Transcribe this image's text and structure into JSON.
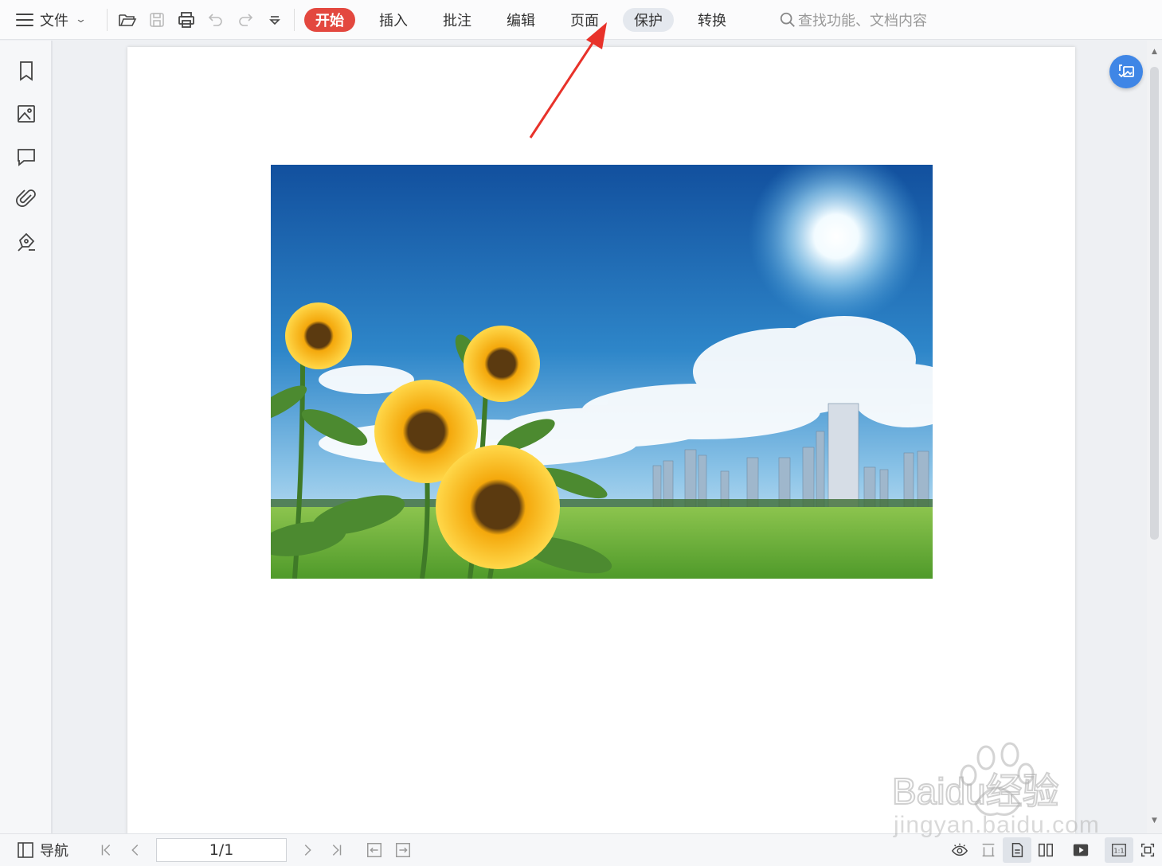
{
  "toolbar": {
    "file_label": "文件",
    "tabs": [
      {
        "label": "开始",
        "state": "active"
      },
      {
        "label": "插入",
        "state": "normal"
      },
      {
        "label": "批注",
        "state": "normal"
      },
      {
        "label": "编辑",
        "state": "normal"
      },
      {
        "label": "页面",
        "state": "normal"
      },
      {
        "label": "保护",
        "state": "hover"
      },
      {
        "label": "转换",
        "state": "normal"
      }
    ],
    "search_placeholder": "查找功能、文档内容",
    "quick_icons": [
      "folder-open-icon",
      "save-icon",
      "print-icon",
      "undo-icon",
      "redo-icon",
      "more-dropdown-icon"
    ]
  },
  "sidebar": {
    "items": [
      "bookmark-icon",
      "thumbnail-icon",
      "comment-icon",
      "attachment-icon",
      "sign-icon"
    ]
  },
  "document": {
    "image_subject": "sunflowers, city skyline, blue sky with sun"
  },
  "statusbar": {
    "nav_label": "导航",
    "page_indicator": "1/1"
  },
  "watermark": {
    "brand": "Baidu经验",
    "url": "jingyan.baidu.com"
  },
  "colors": {
    "active_tab": "#e3483f",
    "hover_tab": "#e4e8ee",
    "float_button": "#3f86e6",
    "annotation_arrow": "#e8322a"
  }
}
